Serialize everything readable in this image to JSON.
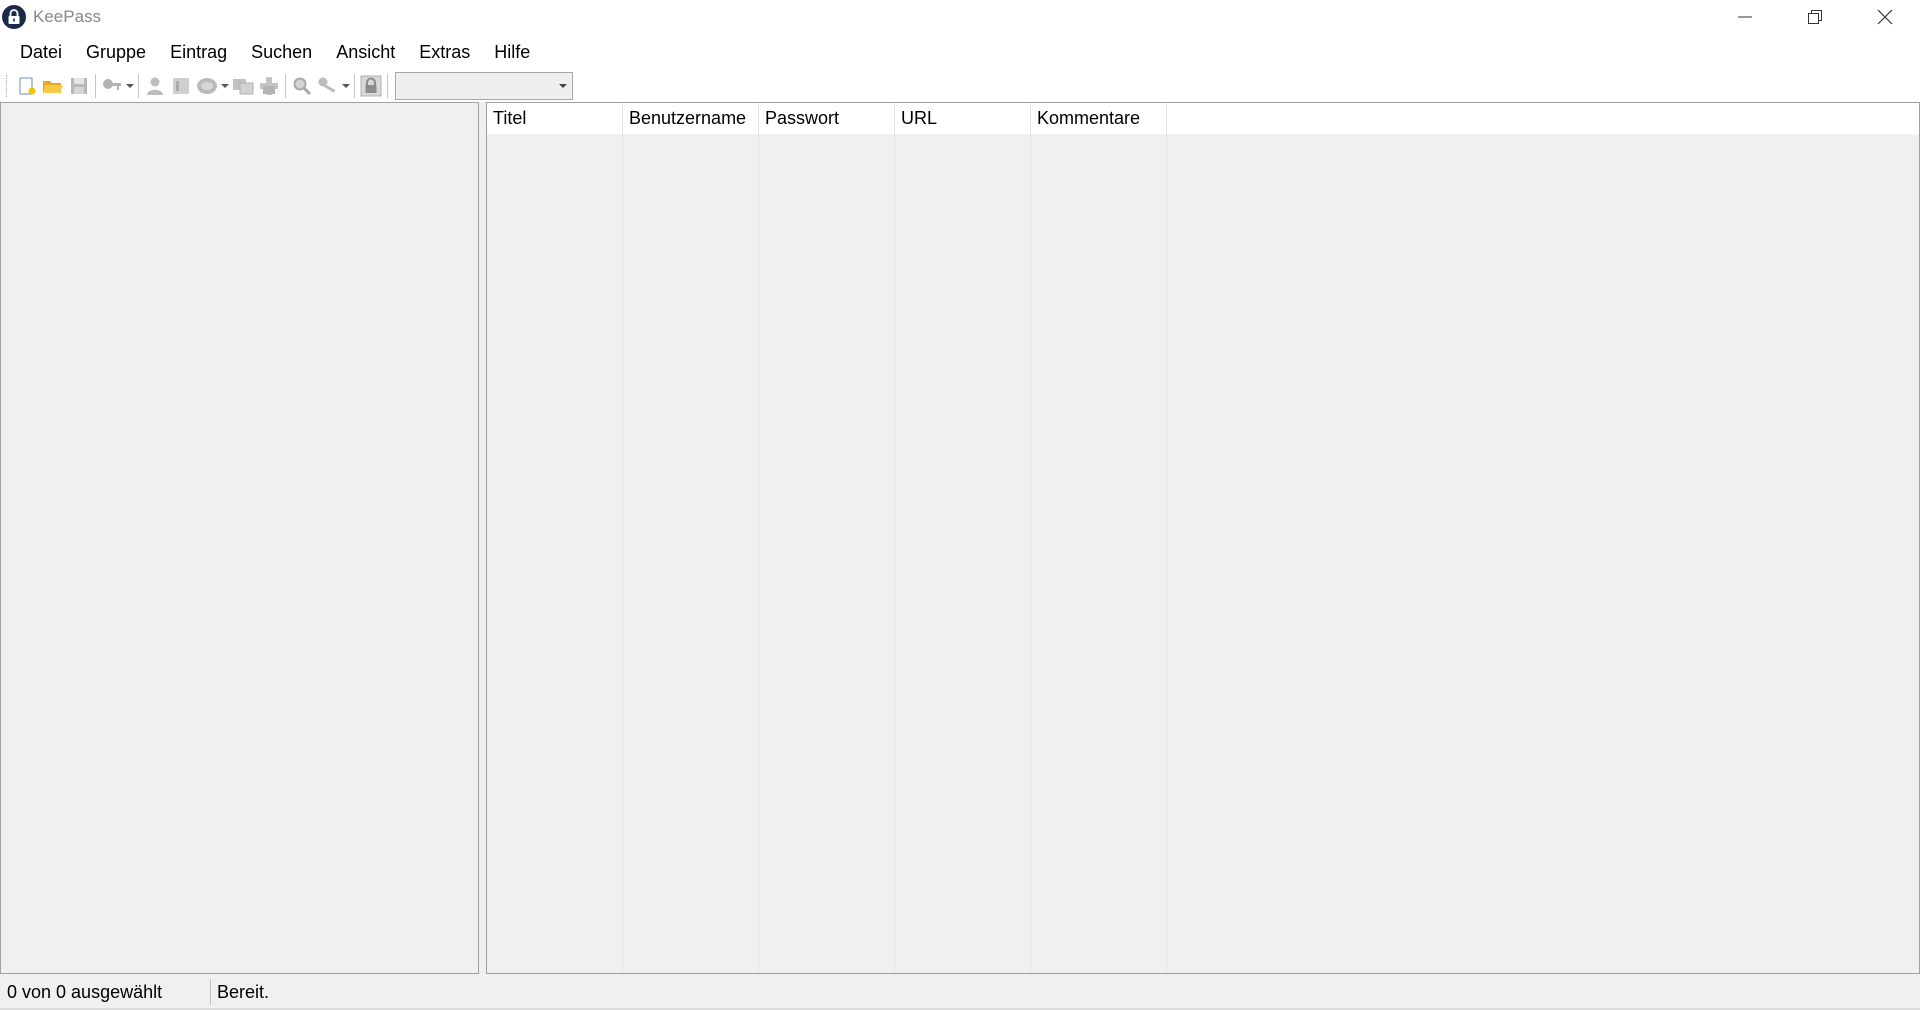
{
  "window": {
    "title": "KeePass",
    "controls": [
      "minimize-icon",
      "restore-icon",
      "close-icon"
    ]
  },
  "menu": {
    "items": [
      "Datei",
      "Gruppe",
      "Eintrag",
      "Suchen",
      "Ansicht",
      "Extras",
      "Hilfe"
    ]
  },
  "toolbar": {
    "buttons": [
      "new-database-icon",
      "open-database-icon",
      "save-database-icon",
      "add-entry-icon",
      "copy-username-icon",
      "copy-password-icon",
      "open-url-icon",
      "sync-icon",
      "perform-auto-type-icon",
      "find-icon",
      "entry-views-icon",
      "lock-workspace-icon"
    ],
    "quick_search": {
      "value": ""
    }
  },
  "entry_list": {
    "columns": [
      "Titel",
      "Benutzername",
      "Passwort",
      "URL",
      "Kommentare"
    ],
    "rows": []
  },
  "status": {
    "selection": "0 von 0 ausgewählt",
    "message": "Bereit."
  },
  "colors": {
    "panel_background": "#f0f0f0",
    "chrome_background": "#ffffff",
    "border": "#a0a0a0"
  }
}
